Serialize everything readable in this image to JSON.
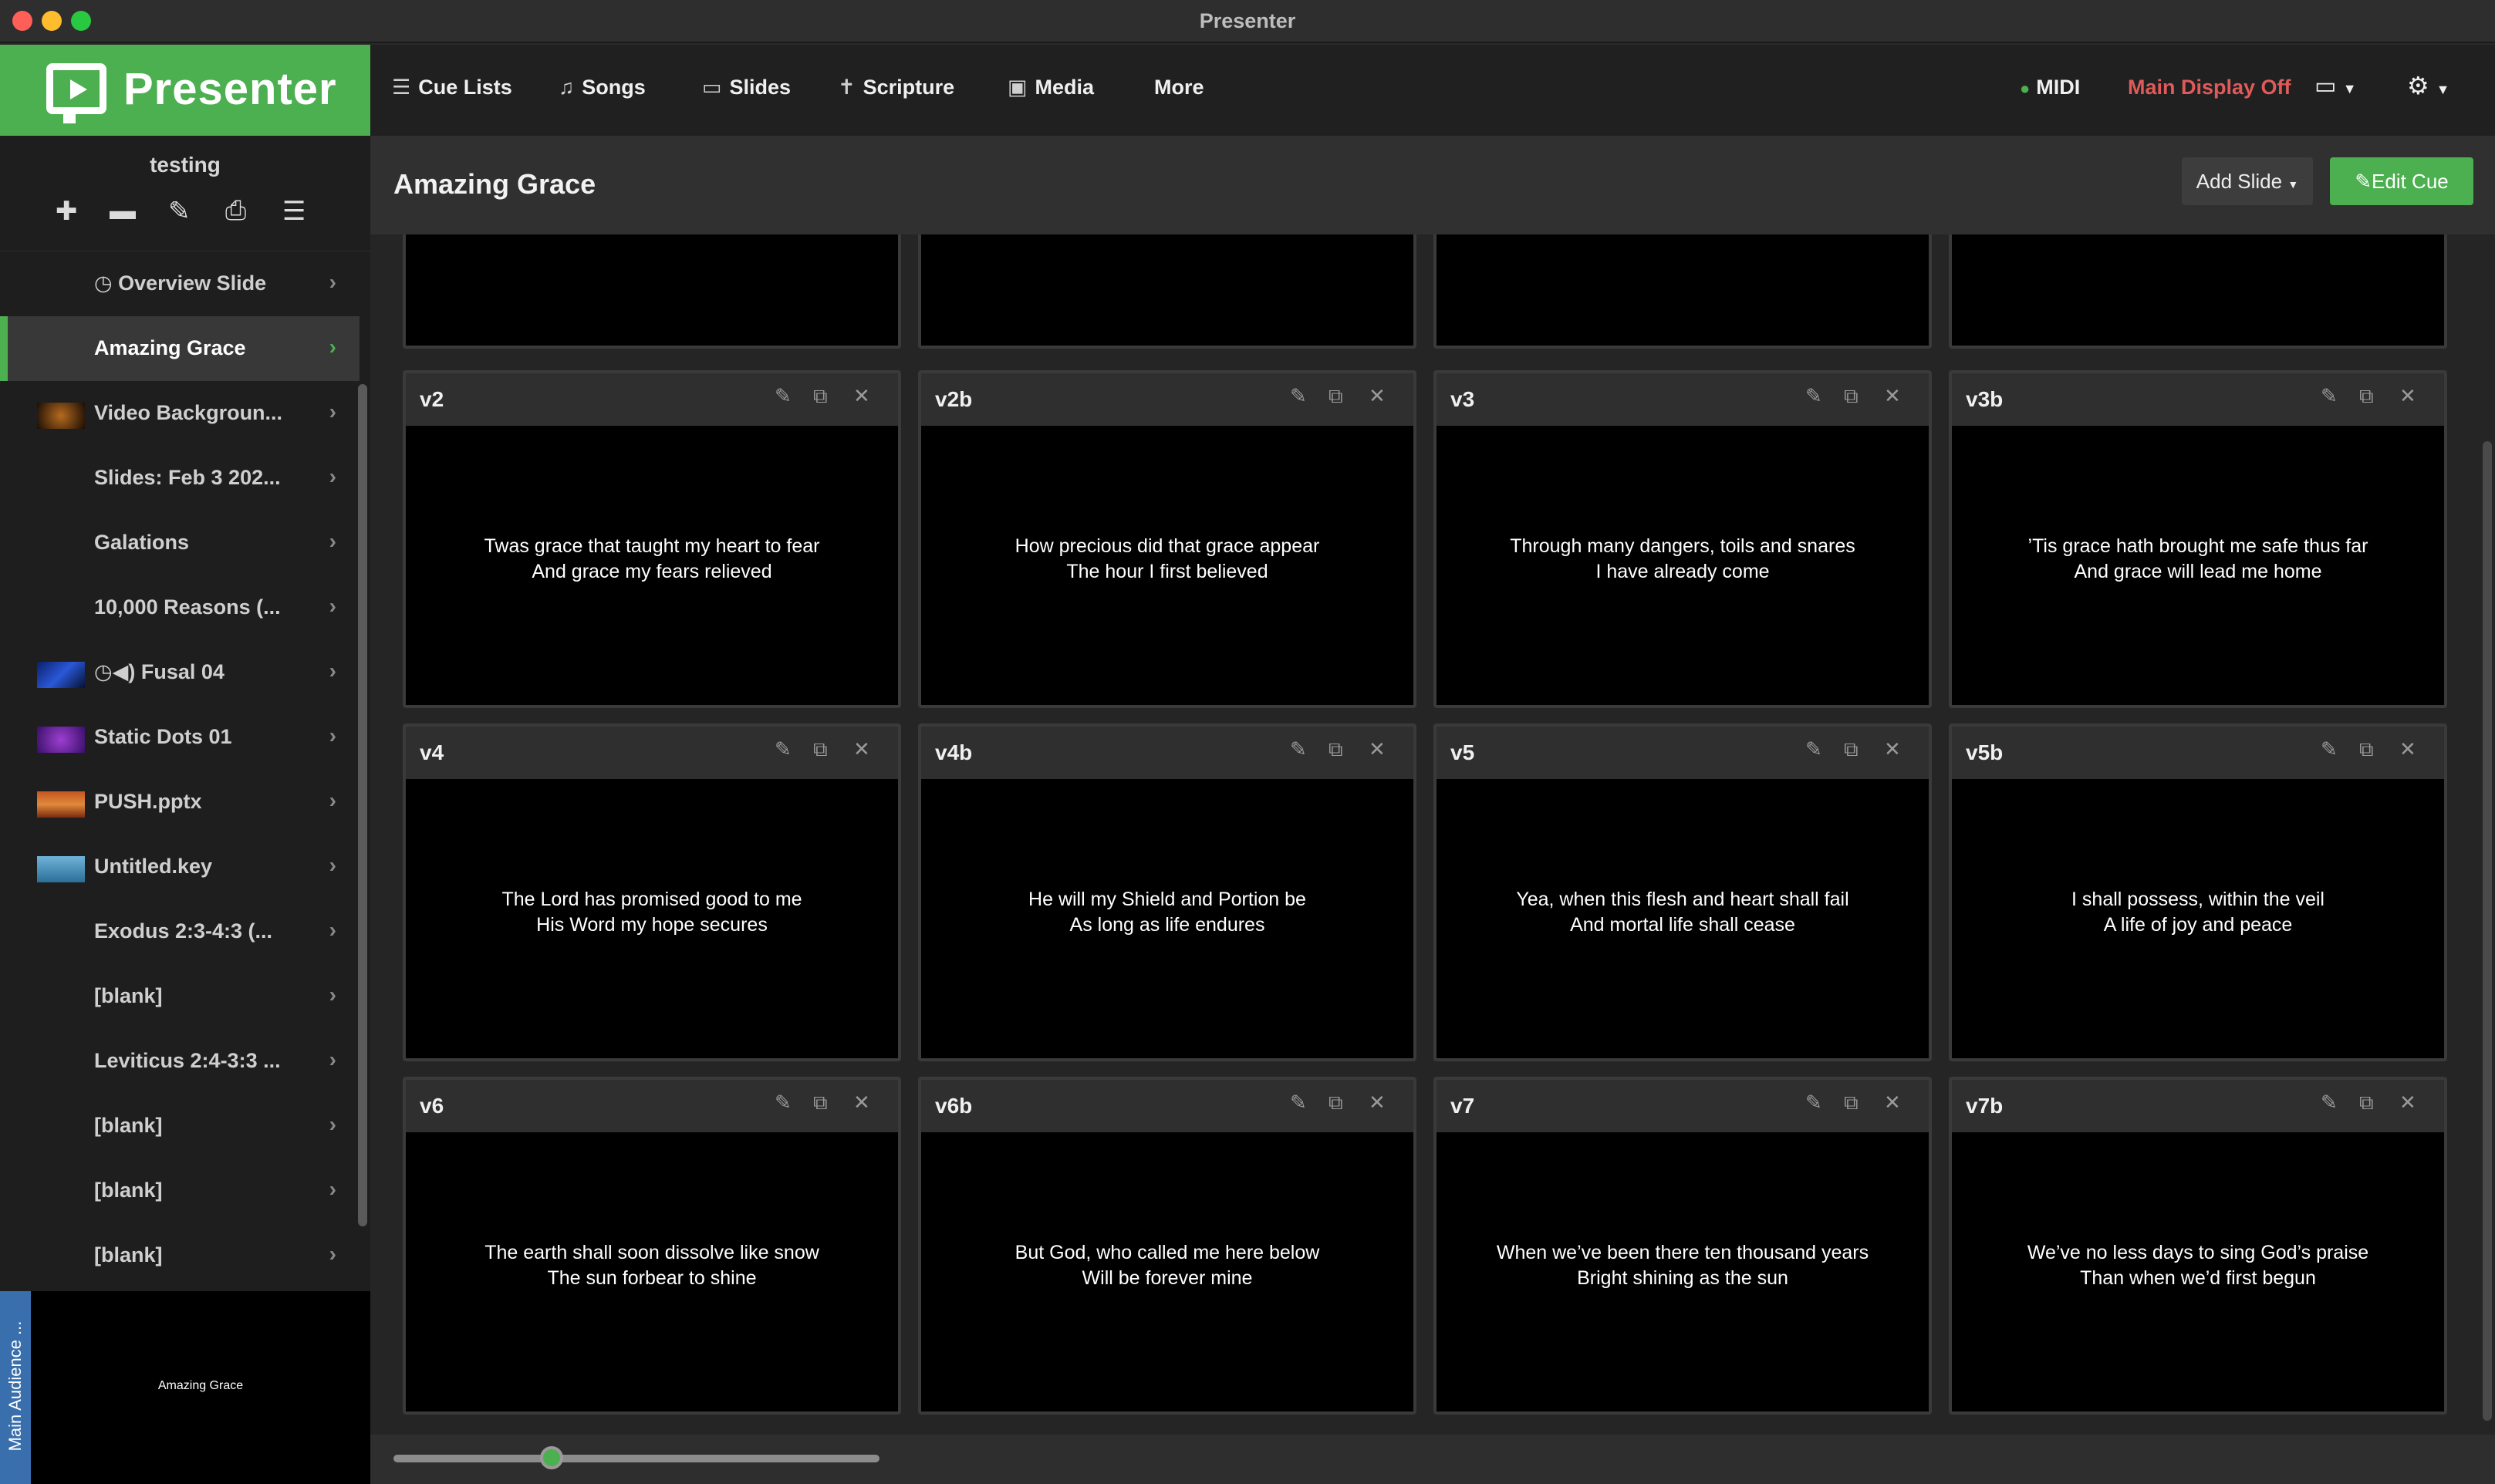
{
  "window": {
    "title": "Presenter"
  },
  "logo": {
    "text": "Presenter"
  },
  "nav": {
    "items": [
      {
        "label": "Cue Lists",
        "icon": "list-icon"
      },
      {
        "label": "Songs",
        "icon": "music-list-icon"
      },
      {
        "label": "Slides",
        "icon": "monitor-icon"
      },
      {
        "label": "Scripture",
        "icon": "bible-icon"
      },
      {
        "label": "Media",
        "icon": "image-icon"
      },
      {
        "label": "More",
        "icon": ""
      }
    ],
    "midi": "MIDI",
    "main_display": "Main Display Off"
  },
  "sidebar": {
    "cue_list_name": "testing",
    "items": [
      {
        "label": "Overview Slide",
        "icon": "clock-icon"
      },
      {
        "label": "Amazing Grace",
        "active": true
      },
      {
        "label": "Video Backgroun..."
      },
      {
        "label": "Slides: Feb 3 202..."
      },
      {
        "label": "Galations"
      },
      {
        "label": "10,000 Reasons (..."
      },
      {
        "label": "Fusal 04",
        "icon": "clock-speaker-icons"
      },
      {
        "label": "Static Dots 01"
      },
      {
        "label": "PUSH.pptx"
      },
      {
        "label": "Untitled.key"
      },
      {
        "label": "Exodus 2:3-4:3 (..."
      },
      {
        "label": "[blank]"
      },
      {
        "label": "Leviticus 2:4-3:3 ..."
      },
      {
        "label": "[blank]"
      },
      {
        "label": "[blank]"
      },
      {
        "label": "[blank]"
      }
    ]
  },
  "preview": {
    "tab_label": "Main Audience ...",
    "text": "Amazing Grace"
  },
  "main": {
    "title": "Amazing Grace",
    "add_slide": "Add Slide",
    "edit_cue": "Edit Cue"
  },
  "slides": [
    {
      "name": "v2",
      "line1": "Twas grace that taught my heart to fear",
      "line2": "And grace my fears relieved"
    },
    {
      "name": "v2b",
      "line1": "How precious did that grace appear",
      "line2": "The hour I first believed"
    },
    {
      "name": "v3",
      "line1": "Through many dangers, toils and snares",
      "line2": "I have already come"
    },
    {
      "name": "v3b",
      "line1": "’Tis grace hath brought me safe thus far",
      "line2": "And grace will lead me home"
    },
    {
      "name": "v4",
      "line1": "The Lord has promised good to me",
      "line2": "His Word my hope secures"
    },
    {
      "name": "v4b",
      "line1": "He will my Shield and Portion be",
      "line2": "As long as life endures"
    },
    {
      "name": "v5",
      "line1": "Yea, when this flesh and heart shall fail",
      "line2": "And mortal life shall cease"
    },
    {
      "name": "v5b",
      "line1": "I shall possess, within the veil",
      "line2": "A life of joy and peace"
    },
    {
      "name": "v6",
      "line1": "The earth shall soon dissolve like snow",
      "line2": "The sun forbear to shine"
    },
    {
      "name": "v6b",
      "line1": "But God, who called me here below",
      "line2": "Will be forever mine"
    },
    {
      "name": "v7",
      "line1": "When we’ve been there ten thousand years",
      "line2": "Bright shining as the sun"
    },
    {
      "name": "v7b",
      "line1": "We’ve no less days to sing God’s praise",
      "line2": "Than when we’d first begun"
    }
  ],
  "colors": {
    "accent": "#4caf50",
    "warning": "#e05a5a",
    "midi_dot": "#4caf50"
  }
}
